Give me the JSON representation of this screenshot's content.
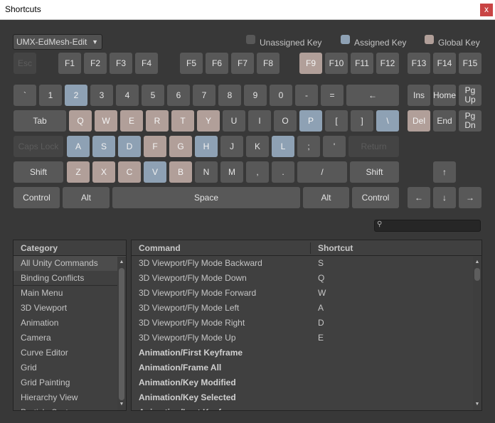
{
  "window": {
    "title": "Shortcuts",
    "close_label": "x"
  },
  "profile": {
    "value": "UMX-EdMesh-Edit"
  },
  "legend": [
    {
      "label": "Unassigned Key",
      "color": "#585858"
    },
    {
      "label": "Assigned Key",
      "color": "#8ea1b4"
    },
    {
      "label": "Global Key",
      "color": "#b19f99"
    }
  ],
  "colors": {
    "unassigned": "#585858",
    "assigned": "#8ea1b4",
    "global": "#b19f99",
    "disabled": "#444444"
  },
  "keyboard": {
    "function_row": [
      "Esc",
      "F1",
      "F2",
      "F3",
      "F4",
      "F5",
      "F6",
      "F7",
      "F8",
      "F9",
      "F10",
      "F11",
      "F12",
      "F13",
      "F14",
      "F15"
    ],
    "number_row": [
      "`",
      "1",
      "2",
      "3",
      "4",
      "5",
      "6",
      "7",
      "8",
      "9",
      "0",
      "-",
      "=",
      "←"
    ],
    "tab_row": [
      "Tab",
      "Q",
      "W",
      "E",
      "R",
      "T",
      "Y",
      "U",
      "I",
      "O",
      "P",
      "[",
      "]",
      "\\"
    ],
    "caps_row": [
      "Caps Lock",
      "A",
      "S",
      "D",
      "F",
      "G",
      "H",
      "J",
      "K",
      "L",
      ";",
      "'",
      "Return"
    ],
    "shift_row": [
      "Shift",
      "Z",
      "X",
      "C",
      "V",
      "B",
      "N",
      "M",
      ",",
      ".",
      "/",
      "Shift"
    ],
    "bottom_row": [
      "Control",
      "Alt",
      "Space",
      "Alt",
      "Control"
    ],
    "nav_keys": [
      "Ins",
      "Home",
      "Pg Up",
      "Del",
      "End",
      "Pg Dn"
    ],
    "arrow_keys": [
      "↑",
      "←",
      "↓",
      "→"
    ]
  },
  "search": {
    "icon": "search-icon"
  },
  "category": {
    "header": "Category",
    "items": [
      "All Unity Commands",
      "Binding Conflicts",
      "Main Menu",
      "3D Viewport",
      "Animation",
      "Camera",
      "Curve Editor",
      "Grid",
      "Grid Painting",
      "Hierarchy View",
      "Particle System"
    ],
    "selected": "All Unity Commands"
  },
  "commands": {
    "header_command": "Command",
    "header_shortcut": "Shortcut",
    "rows": [
      {
        "command": "3D Viewport/Fly Mode Backward",
        "shortcut": "S"
      },
      {
        "command": "3D Viewport/Fly Mode Down",
        "shortcut": "Q"
      },
      {
        "command": "3D Viewport/Fly Mode Forward",
        "shortcut": "W"
      },
      {
        "command": "3D Viewport/Fly Mode Left",
        "shortcut": "A"
      },
      {
        "command": "3D Viewport/Fly Mode Right",
        "shortcut": "D"
      },
      {
        "command": "3D Viewport/Fly Mode Up",
        "shortcut": "E"
      },
      {
        "command": "Animation/First Keyframe",
        "shortcut": ""
      },
      {
        "command": "Animation/Frame All",
        "shortcut": ""
      },
      {
        "command": "Animation/Key Modified",
        "shortcut": ""
      },
      {
        "command": "Animation/Key Selected",
        "shortcut": ""
      },
      {
        "command": "Animation/Last Keyframe",
        "shortcut": ""
      }
    ]
  }
}
